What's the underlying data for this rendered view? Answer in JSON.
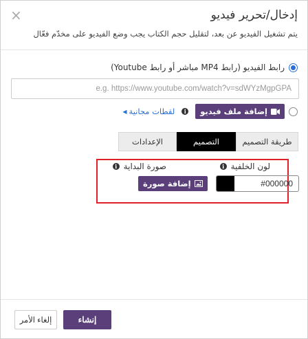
{
  "dialog": {
    "title": "إدخال/تحرير فيديو",
    "subtitle": "يتم تشغيل الفيديو عن بعد، لتقليل حجم الكتاب يجب وضع الفيديو على مخدّم فعّال",
    "close_glyph": "×"
  },
  "source": {
    "url_option_label": "رابط الفيديو (رابط MP4 مباشر أو رابط Youtube)",
    "url_option_selected": true,
    "url_placeholder": "e.g. https://www.youtube.com/watch?v=sdWYzMgpGPA",
    "url_value": "",
    "upload_option_selected": false,
    "upload_button_label": "إضافة ملف فيديو",
    "free_clips_link": "لقطات مجانية",
    "info_glyph": "i"
  },
  "tabs": [
    {
      "label": "طريقة التصميم",
      "active": false
    },
    {
      "label": "التصميم",
      "active": true
    },
    {
      "label": "الإعدادات",
      "active": false
    }
  ],
  "design": {
    "background_color_label": "لون الخلفية",
    "background_color_value": "#000000",
    "start_image_label": "صورة البداية",
    "add_image_button_label": "إضافة صورة"
  },
  "footer": {
    "create_label": "إنشاء",
    "cancel_label": "إلغاء الأمر"
  },
  "colors": {
    "accent_purple": "#5a3f7a",
    "link_blue": "#2a6fd6",
    "highlight_red": "#e0202a"
  }
}
